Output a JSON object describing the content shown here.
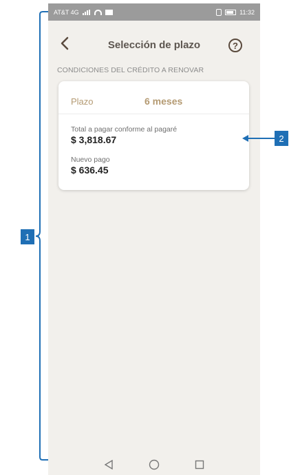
{
  "statusbar": {
    "carrier": "AT&T 4G",
    "time": "11:32"
  },
  "header": {
    "back_icon": "chevron-left-icon",
    "title": "Selección de plazo",
    "help_label": "?"
  },
  "section_label": "CONDICIONES DEL CRÉDITO A RENOVAR",
  "card": {
    "plazo_label": "Plazo",
    "plazo_value": "6 meses",
    "total_label": "Total a pagar conforme al pagaré",
    "total_value": "$ 3,818.67",
    "nuevo_label": "Nuevo pago",
    "nuevo_value": "$ 636.45"
  },
  "callouts": {
    "one": "1",
    "two": "2"
  },
  "colors": {
    "accent_gold": "#b49a72",
    "callout_blue": "#1f6fb5",
    "background": "#f2f0ec"
  }
}
